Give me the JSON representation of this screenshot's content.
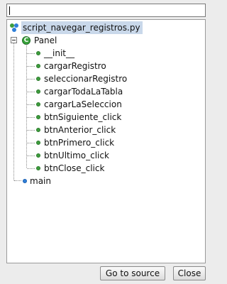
{
  "search": {
    "value": ""
  },
  "tree": {
    "module": {
      "label": "script_navegar_registros.py",
      "icon": "python-module-icon"
    },
    "class": {
      "label": "Panel",
      "icon": "class-c-icon"
    },
    "methods": [
      "__init__",
      "cargarRegistro",
      "seleccionarRegistro",
      "cargarTodaLaTabla",
      "cargarLaSeleccion",
      "btnSiguiente_click",
      "btnAnterior_click",
      "btnPrimero_click",
      "btnUltimo_click",
      "btnClose_click"
    ],
    "function": {
      "label": "main",
      "icon": "function-dot-icon"
    }
  },
  "buttons": {
    "go_to_source": "Go to source",
    "close": "Close"
  },
  "colors": {
    "method_dot": "#3e9c3e",
    "function_dot": "#2f7fd8",
    "selection": "#c9d8ea"
  }
}
